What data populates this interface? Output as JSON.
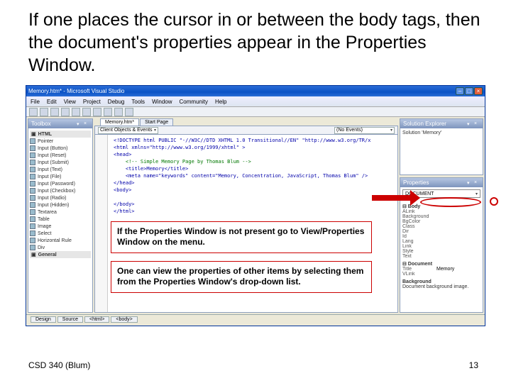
{
  "title": "If one places the cursor in or between the body tags, then the document's properties appear in the Properties Window.",
  "footer": {
    "left": "CSD 340 (Blum)",
    "page": "13"
  },
  "annotations": {
    "a1": "If the Properties Window is not present go to View/Properties Window on the menu.",
    "a2": "One can view the properties of other items by selecting them from the Properties Window's drop-down list."
  },
  "ide": {
    "windowTitle": "Memory.htm* - Microsoft Visual Studio",
    "menu": [
      "File",
      "Edit",
      "View",
      "Project",
      "Debug",
      "Tools",
      "Window",
      "Community",
      "Help"
    ],
    "toolbox": {
      "title": "Toolbox",
      "groupLabel": "HTML",
      "items": [
        "Pointer",
        "Input (Button)",
        "Input (Reset)",
        "Input (Submit)",
        "Input (Text)",
        "Input (File)",
        "Input (Password)",
        "Input (Checkbox)",
        "Input (Radio)",
        "Input (Hidden)",
        "Textarea",
        "Table",
        "Image",
        "Select",
        "Horizontal Rule",
        "Div"
      ],
      "groupLabel2": "General"
    },
    "editor": {
      "tabs": [
        "Memory.htm*",
        "Start Page"
      ],
      "activeTab": "Memory.htm*",
      "clientDropdown": "Client Objects & Events",
      "eventDropdown": "(No Events)",
      "codeLines": [
        {
          "cls": "bl",
          "t": "<!DOCTYPE html PUBLIC \"-//W3C//DTD XHTML 1.0 Transitional//EN\" \"http://www.w3.org/TR/x"
        },
        {
          "cls": "bl",
          "t": "<html xmlns=\"http://www.w3.org/1999/xhtml\" >"
        },
        {
          "cls": "bl",
          "t": "<head>"
        },
        {
          "cls": "gr",
          "t": "    <!-- Simple Memory Page by Thomas Blum -->"
        },
        {
          "cls": "bl",
          "t": "    <title>Memory</title>"
        },
        {
          "cls": "bl",
          "t": "    <meta name=\"keywords\" content=\"Memory, Concentration, JavaScript, Thomas Blum\" />"
        },
        {
          "cls": "bl",
          "t": "</head>"
        },
        {
          "cls": "bl",
          "t": "<body>"
        },
        {
          "cls": "",
          "t": ""
        },
        {
          "cls": "bl",
          "t": "</body>"
        },
        {
          "cls": "bl",
          "t": "</html>"
        }
      ],
      "bottomTabs": [
        "Design",
        "Source",
        "<html>",
        "<body>"
      ]
    },
    "solution": {
      "title": "Solution Explorer",
      "root": "Solution 'Memory'"
    },
    "properties": {
      "title": "Properties",
      "selected": "DOCUMENT",
      "rows": [
        {
          "k": "ALink",
          "v": ""
        },
        {
          "k": "Background",
          "v": ""
        },
        {
          "k": "BgColor",
          "v": ""
        },
        {
          "k": "Class",
          "v": ""
        },
        {
          "k": "Dir",
          "v": ""
        },
        {
          "k": "Id",
          "v": ""
        },
        {
          "k": "Lang",
          "v": ""
        },
        {
          "k": "Link",
          "v": ""
        },
        {
          "k": "Style",
          "v": ""
        },
        {
          "k": "Text",
          "v": ""
        },
        {
          "k": "Title",
          "v": "Memory"
        },
        {
          "k": "VLink",
          "v": ""
        }
      ],
      "sectionBody": "Body",
      "sectionDoc": "Document",
      "descLabel": "Background",
      "descText": "Document background image."
    }
  }
}
